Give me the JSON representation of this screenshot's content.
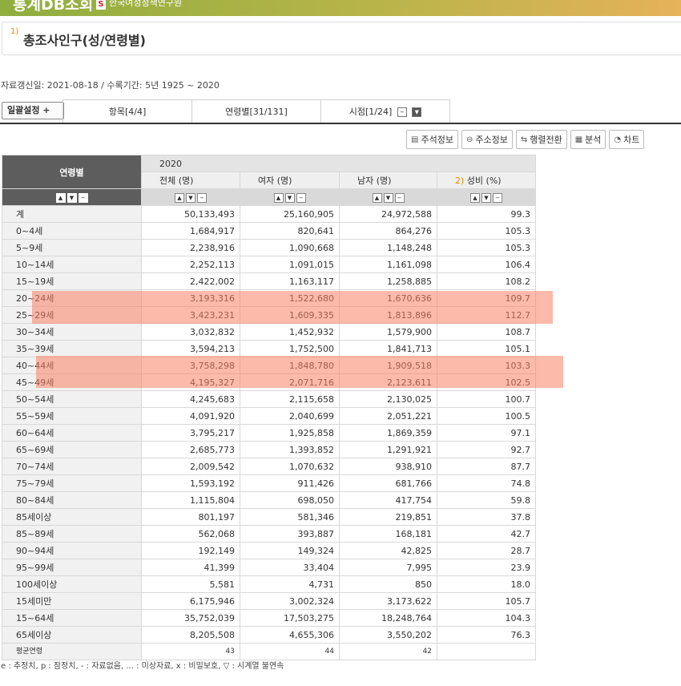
{
  "header": {
    "brand": "통계DB조회",
    "org_logo": "S",
    "org": "한국여성정책연구원"
  },
  "title": {
    "index": "1)",
    "text": "총조사인구(성/연령별)"
  },
  "meta": "자료갱신일: 2021-08-18 / 수록기간: 5년 1925 ~ 2020",
  "settings_label": "일괄설정 +",
  "tabs": [
    "항목[4/4]",
    "연령별[31/131]",
    "시점[1/24]"
  ],
  "toolbar": [
    {
      "icon": "memo-icon",
      "glyph": "▤",
      "label": "주석정보"
    },
    {
      "icon": "link-icon",
      "glyph": "⊖",
      "label": "주소정보"
    },
    {
      "icon": "transpose-icon",
      "glyph": "⇆",
      "label": "행렬전환"
    },
    {
      "icon": "analysis-icon",
      "glyph": "▦",
      "label": "분석"
    },
    {
      "icon": "chart-icon",
      "glyph": "◔",
      "label": "차트"
    }
  ],
  "table": {
    "row_header": "연령별",
    "year": "2020",
    "columns": [
      "전체 (명)",
      "여자 (명)",
      "남자 (명)",
      "성비 (%)"
    ],
    "ratio_index": "2)",
    "rows": [
      [
        "계",
        "50,133,493",
        "25,160,905",
        "24,972,588",
        "99.3"
      ],
      [
        "0~4세",
        "1,684,917",
        "820,641",
        "864,276",
        "105.3"
      ],
      [
        "5~9세",
        "2,238,916",
        "1,090,668",
        "1,148,248",
        "105.3"
      ],
      [
        "10~14세",
        "2,252,113",
        "1,091,015",
        "1,161,098",
        "106.4"
      ],
      [
        "15~19세",
        "2,422,002",
        "1,163,117",
        "1,258,885",
        "108.2"
      ],
      [
        "20~24세",
        "3,193,316",
        "1,522,680",
        "1,670,636",
        "109.7"
      ],
      [
        "25~29세",
        "3,423,231",
        "1,609,335",
        "1,813,896",
        "112.7"
      ],
      [
        "30~34세",
        "3,032,832",
        "1,452,932",
        "1,579,900",
        "108.7"
      ],
      [
        "35~39세",
        "3,594,213",
        "1,752,500",
        "1,841,713",
        "105.1"
      ],
      [
        "40~44세",
        "3,758,298",
        "1,848,780",
        "1,909,518",
        "103.3"
      ],
      [
        "45~49세",
        "4,195,327",
        "2,071,716",
        "2,123,611",
        "102.5"
      ],
      [
        "50~54세",
        "4,245,683",
        "2,115,658",
        "2,130,025",
        "100.7"
      ],
      [
        "55~59세",
        "4,091,920",
        "2,040,699",
        "2,051,221",
        "100.5"
      ],
      [
        "60~64세",
        "3,795,217",
        "1,925,858",
        "1,869,359",
        "97.1"
      ],
      [
        "65~69세",
        "2,685,773",
        "1,393,852",
        "1,291,921",
        "92.7"
      ],
      [
        "70~74세",
        "2,009,542",
        "1,070,632",
        "938,910",
        "87.7"
      ],
      [
        "75~79세",
        "1,593,192",
        "911,426",
        "681,766",
        "74.8"
      ],
      [
        "80~84세",
        "1,115,804",
        "698,050",
        "417,754",
        "59.8"
      ],
      [
        "85세이상",
        "801,197",
        "581,346",
        "219,851",
        "37.8"
      ],
      [
        "85~89세",
        "562,068",
        "393,887",
        "168,181",
        "42.7"
      ],
      [
        "90~94세",
        "192,149",
        "149,324",
        "42,825",
        "28.7"
      ],
      [
        "95~99세",
        "41,399",
        "33,404",
        "7,995",
        "23.9"
      ],
      [
        "100세이상",
        "5,581",
        "4,731",
        "850",
        "18.0"
      ],
      [
        "15세미만",
        "6,175,946",
        "3,002,324",
        "3,173,622",
        "105.7"
      ],
      [
        "15~64세",
        "35,752,039",
        "17,503,275",
        "18,248,764",
        "104.3"
      ],
      [
        "65세이상",
        "8,205,508",
        "4,655,306",
        "3,550,202",
        "76.3"
      ]
    ],
    "partial_row": [
      "평균연령",
      "43",
      "44",
      "42"
    ]
  },
  "footnote": "e : 추정치, p : 잠정치, - : 자료없음, ... : 미상자료, x : 비밀보호, ▽ : 시계열 불연속",
  "highlight_color": "#f88264"
}
